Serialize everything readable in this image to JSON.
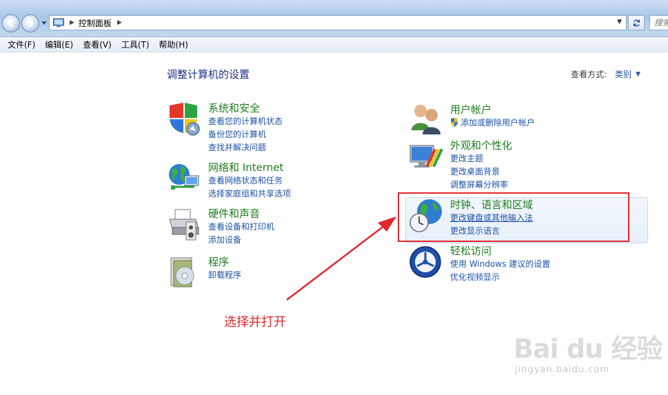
{
  "address_bar": {
    "crumb": "控制面板",
    "search_placeholder": "搜索"
  },
  "menu": [
    "文件(F)",
    "编辑(E)",
    "查看(V)",
    "工具(T)",
    "帮助(H)"
  ],
  "page": {
    "title": "调整计算机的设置",
    "view_by_label": "查看方式:",
    "view_by_value": "类别"
  },
  "categories_left": [
    {
      "title": "系统和安全",
      "links": [
        "查看您的计算机状态",
        "备份您的计算机",
        "查找并解决问题"
      ],
      "icon": "shield-icon"
    },
    {
      "title": "网络和 Internet",
      "links": [
        "查看网络状态和任务",
        "选择家庭组和共享选项"
      ],
      "icon": "network-globe-icon"
    },
    {
      "title": "硬件和声音",
      "links": [
        "查看设备和打印机",
        "添加设备"
      ],
      "icon": "printer-icon"
    },
    {
      "title": "程序",
      "links": [
        "卸载程序"
      ],
      "icon": "programs-icon"
    }
  ],
  "categories_right": [
    {
      "title": "用户帐户",
      "links": [
        "添加或删除用户帐户"
      ],
      "icon": "users-icon"
    },
    {
      "title": "外观和个性化",
      "links": [
        "更改主题",
        "更改桌面背景",
        "调整屏幕分辨率"
      ],
      "icon": "appearance-icon"
    },
    {
      "title": "时钟、语言和区域",
      "links": [
        "更改键盘或其他输入法",
        "更改显示语言"
      ],
      "icon": "clock-globe-icon"
    },
    {
      "title": "轻松访问",
      "links": [
        "使用 Windows 建议的设置",
        "优化视频显示"
      ],
      "icon": "ease-of-access-icon"
    }
  ],
  "annotation": "选择并打开",
  "watermark": {
    "brand": "Bai du 经验",
    "url": "jingyan.baidu.com"
  },
  "colors": {
    "category_title": "#1d7d1d",
    "link": "#1e52a8",
    "annotation_red": "#e3262a"
  }
}
